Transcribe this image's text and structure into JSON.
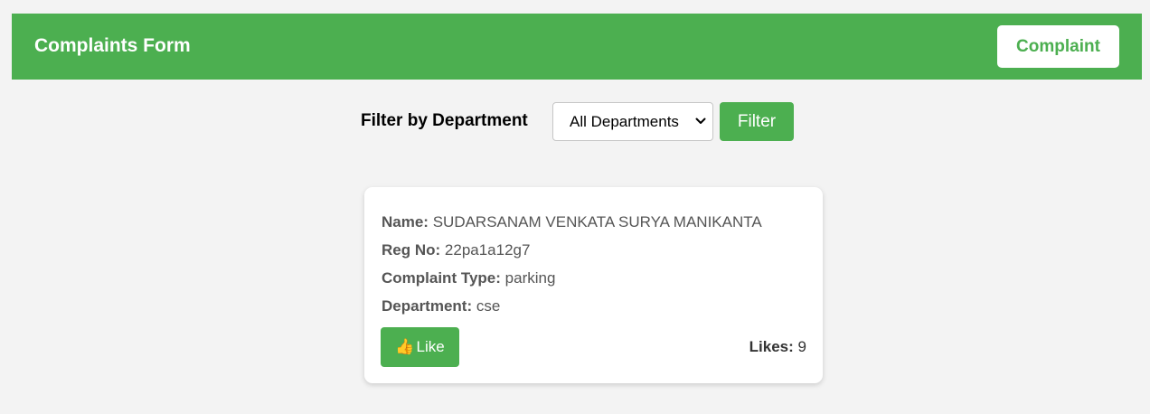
{
  "header": {
    "title": "Complaints Form",
    "complaint_button_label": "Complaint"
  },
  "filter": {
    "label": "Filter by Department",
    "select_value": "All Departments",
    "button_label": "Filter"
  },
  "complaints": [
    {
      "name_label": "Name:",
      "name": "SUDARSANAM VENKATA SURYA MANIKANTA",
      "reg_label": "Reg No:",
      "reg_no": "22pa1a12g7",
      "type_label": "Complaint Type:",
      "complaint_type": "parking",
      "dept_label": "Department:",
      "department": "cse",
      "like_icon": "👍",
      "like_button_label": "Like",
      "likes_label": "Likes:",
      "likes": "9"
    }
  ],
  "colors": {
    "accent": "#4caf50",
    "background": "#f3f3f3",
    "card": "#ffffff"
  }
}
